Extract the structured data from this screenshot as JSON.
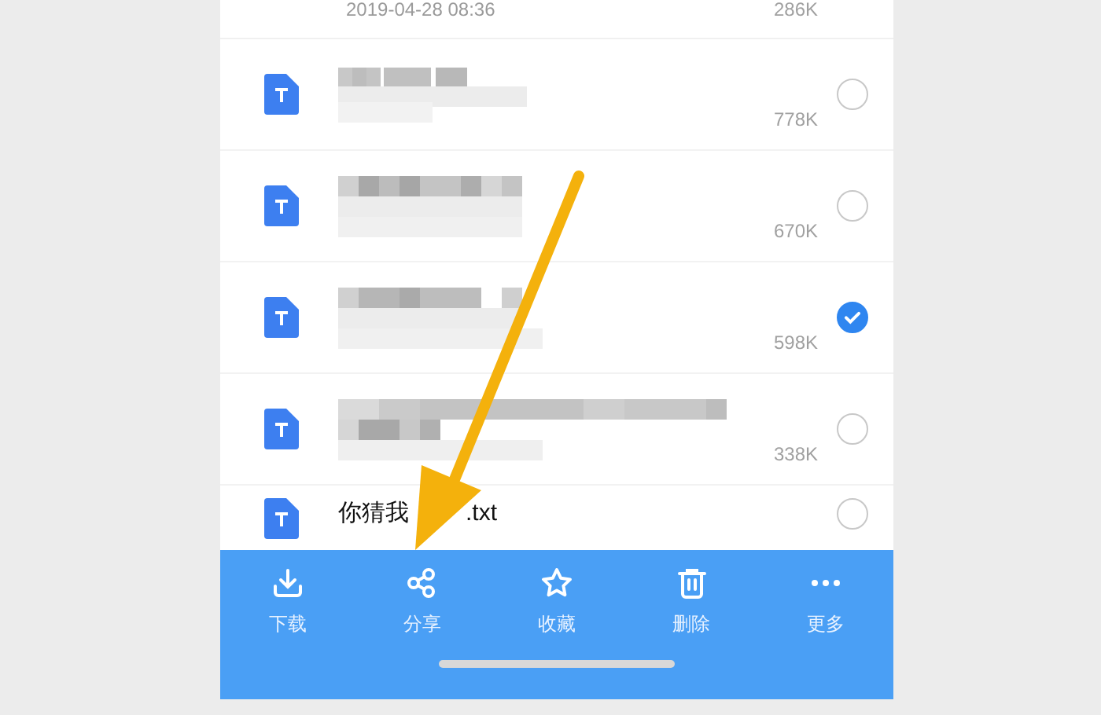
{
  "top_row": {
    "date": "2019-04-28 08:36",
    "size": "286K"
  },
  "files": [
    {
      "size": "778K",
      "selected": false
    },
    {
      "size": "670K",
      "selected": false
    },
    {
      "size": "598K",
      "selected": true
    },
    {
      "size": "338K",
      "selected": false
    },
    {
      "name_parts": [
        "你猜我",
        ".txt"
      ],
      "selected": false
    }
  ],
  "toolbar": [
    {
      "label": "下载"
    },
    {
      "label": "分享"
    },
    {
      "label": "收藏"
    },
    {
      "label": "删除"
    },
    {
      "label": "更多"
    }
  ]
}
